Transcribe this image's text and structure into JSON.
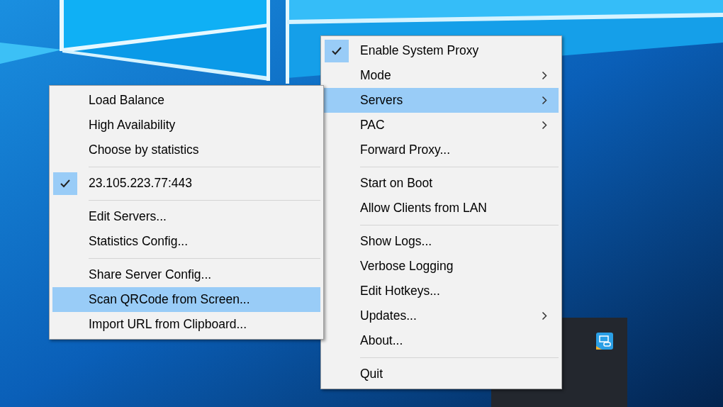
{
  "main_menu": {
    "items": [
      {
        "kind": "item",
        "label": "Enable System Proxy",
        "checked": true,
        "selected": false,
        "submenu": false
      },
      {
        "kind": "item",
        "label": "Mode",
        "checked": false,
        "selected": false,
        "submenu": true
      },
      {
        "kind": "item",
        "label": "Servers",
        "checked": false,
        "selected": true,
        "submenu": true
      },
      {
        "kind": "item",
        "label": "PAC",
        "checked": false,
        "selected": false,
        "submenu": true
      },
      {
        "kind": "item",
        "label": "Forward Proxy...",
        "checked": false,
        "selected": false,
        "submenu": false
      },
      {
        "kind": "separator"
      },
      {
        "kind": "item",
        "label": "Start on Boot",
        "checked": false,
        "selected": false,
        "submenu": false
      },
      {
        "kind": "item",
        "label": "Allow Clients from LAN",
        "checked": false,
        "selected": false,
        "submenu": false
      },
      {
        "kind": "separator"
      },
      {
        "kind": "item",
        "label": "Show Logs...",
        "checked": false,
        "selected": false,
        "submenu": false
      },
      {
        "kind": "item",
        "label": "Verbose Logging",
        "checked": false,
        "selected": false,
        "submenu": false
      },
      {
        "kind": "item",
        "label": "Edit Hotkeys...",
        "checked": false,
        "selected": false,
        "submenu": false
      },
      {
        "kind": "item",
        "label": "Updates...",
        "checked": false,
        "selected": false,
        "submenu": true
      },
      {
        "kind": "item",
        "label": "About...",
        "checked": false,
        "selected": false,
        "submenu": false
      },
      {
        "kind": "separator"
      },
      {
        "kind": "item",
        "label": "Quit",
        "checked": false,
        "selected": false,
        "submenu": false
      }
    ]
  },
  "servers_menu": {
    "items": [
      {
        "kind": "item",
        "label": "Load Balance",
        "checked": false,
        "selected": false,
        "submenu": false
      },
      {
        "kind": "item",
        "label": "High Availability",
        "checked": false,
        "selected": false,
        "submenu": false
      },
      {
        "kind": "item",
        "label": "Choose by statistics",
        "checked": false,
        "selected": false,
        "submenu": false
      },
      {
        "kind": "separator"
      },
      {
        "kind": "item",
        "label": "23.105.223.77:443",
        "checked": true,
        "selected": false,
        "submenu": false
      },
      {
        "kind": "separator"
      },
      {
        "kind": "item",
        "label": "Edit Servers...",
        "checked": false,
        "selected": false,
        "submenu": false
      },
      {
        "kind": "item",
        "label": "Statistics Config...",
        "checked": false,
        "selected": false,
        "submenu": false
      },
      {
        "kind": "separator"
      },
      {
        "kind": "item",
        "label": "Share Server Config...",
        "checked": false,
        "selected": false,
        "submenu": false
      },
      {
        "kind": "item",
        "label": "Scan QRCode from Screen...",
        "checked": false,
        "selected": true,
        "submenu": false
      },
      {
        "kind": "item",
        "label": "Import URL from Clipboard...",
        "checked": false,
        "selected": false,
        "submenu": false
      }
    ]
  }
}
